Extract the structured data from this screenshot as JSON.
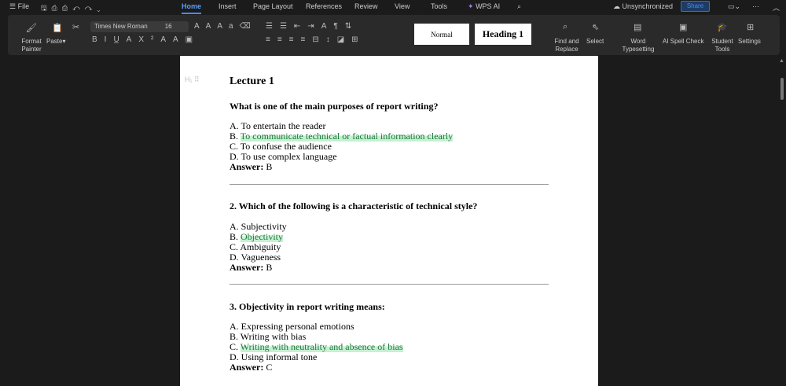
{
  "menu": {
    "file": "File",
    "tabs": [
      "Home",
      "Insert",
      "Page Layout",
      "References",
      "Review",
      "View",
      "Tools"
    ],
    "wps_ai": "WPS AI",
    "sync_status": "Unsynchronized",
    "share": "Share"
  },
  "ribbon": {
    "format_painter": "Format Painter",
    "paste": "Paste",
    "font_name": "Times New Roman",
    "font_size": "16",
    "style_normal": "Normal",
    "style_heading": "Heading 1",
    "find_replace": "Find and Replace",
    "select": "Select",
    "word_typesetting": "Word Typesetting",
    "ai_spell_check": "AI Spell Check",
    "student_tools": "Student Tools",
    "settings": "Settings"
  },
  "document": {
    "title": "Lecture 1",
    "questions": [
      {
        "q": "What is one of the main purposes of report writing?",
        "options": [
          "A. To entertain the reader",
          "B. To communicate technical or factual information clearly",
          "C. To confuse the audience",
          "D. To use complex language"
        ],
        "answer_label": "Answer:",
        "answer": " B"
      },
      {
        "q": "2. Which of the following is a characteristic of technical style?",
        "options": [
          "A. Subjectivity",
          "B. Objectivity",
          "C. Ambiguity",
          "D. Vagueness"
        ],
        "answer_label": "Answer:",
        "answer": " B"
      },
      {
        "q": "3. Objectivity in report writing means:",
        "options": [
          "A. Expressing personal emotions",
          "B. Writing with bias",
          "C. Writing with neutrality and absence of bias",
          "D. Using informal tone"
        ],
        "answer_label": "Answer:",
        "answer": " C"
      }
    ]
  },
  "colors": {
    "accent": "#4a8af4",
    "highlight": "#c7f0d3"
  }
}
